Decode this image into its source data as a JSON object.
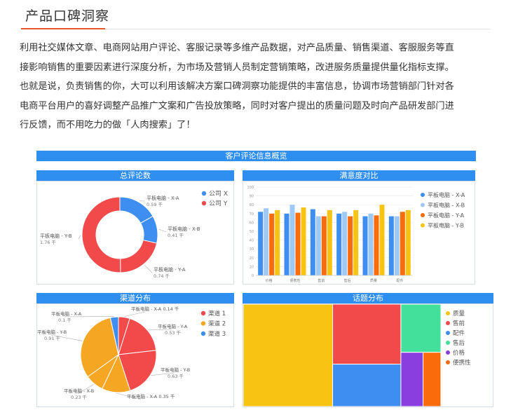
{
  "header": {
    "title": "产品口碑洞察"
  },
  "intro": {
    "lines": [
      "利用社交媒体文章、电商网站用户评论、客服记录等多维产品数据，对产品质量、销售渠道、客服服务等直",
      "接影响销售的重要因素进行深度分析，为市场及营销人员制定营销策略，改进服务质量提供量化指标支撑。",
      "也就是说，负责销售的你，大可以利用该解决方案口碑洞察功能提供的丰富信息，协调市场营销部门针对各",
      "电商平台用户的喜好调整产品推广文案和广告投放策略，同时对客户提出的质量问题及时向产品研发部门进",
      "行反馈，而不用吃力的做「人肉搜索」了！"
    ]
  },
  "dashboard": {
    "title": "客户评论信息概览"
  },
  "colors": {
    "blue": "#3d8ef0",
    "red": "#f24a4a",
    "orange": "#f5a623",
    "lightblue": "#9ec9f5",
    "yellow": "#f8c414",
    "green": "#43e09c",
    "purple": "#8a3ee0",
    "deeporange": "#f96b0b"
  },
  "chart_data": [
    {
      "type": "pie",
      "title": "总评论数",
      "legend": [
        "公司 X",
        "公司 Y"
      ],
      "slices": [
        {
          "label": "平板电脑 - X-A",
          "value": 0.59,
          "value_label": "0.59 千",
          "group": "公司 X"
        },
        {
          "label": "平板电脑 - X-B",
          "value": 0.41,
          "value_label": "0.41 千",
          "group": "公司 X"
        },
        {
          "label": "平板电脑 - Y-A",
          "value": 0.74,
          "value_label": "0.74 千",
          "group": "公司 Y"
        },
        {
          "label": "平板电脑 - Y-B",
          "value": 1.76,
          "value_label": "1.76 千",
          "group": "公司 Y"
        }
      ]
    },
    {
      "type": "bar",
      "title": "满意度对比",
      "categories": [
        "价格",
        "便携性",
        "售前",
        "售后",
        "质量",
        "配件"
      ],
      "ylim": [
        0,
        100
      ],
      "yticks": [
        0,
        10,
        20,
        30,
        40,
        50,
        60,
        70,
        80,
        90,
        100
      ],
      "series": [
        {
          "name": "平板电脑 - X-A",
          "values": [
            72,
            70,
            75,
            70,
            67,
            67
          ]
        },
        {
          "name": "平板电脑 - X-B",
          "values": [
            76,
            80,
            67,
            72,
            70,
            67
          ]
        },
        {
          "name": "平板电脑 - Y-A",
          "values": [
            70,
            71,
            67,
            67,
            68,
            72
          ]
        },
        {
          "name": "平板电脑 - Y-B",
          "values": [
            74,
            77,
            74,
            74,
            80,
            74
          ]
        }
      ]
    },
    {
      "type": "pie",
      "title": "渠道分布",
      "legend": [
        "渠道 1",
        "渠道 2",
        "渠道 3"
      ],
      "slices": [
        {
          "label": "平板电脑 - X-A",
          "value": 0.14,
          "value_label": "0.14 千",
          "group": "渠道 1"
        },
        {
          "label": "平板电脑 - Y-A",
          "value": 0.53,
          "value_label": "0.53 千",
          "group": "渠道 1"
        },
        {
          "label": "平板电脑 - Y-B",
          "value": 0.63,
          "value_label": "0.63 千",
          "group": "渠道 1"
        },
        {
          "label": "平板电脑 - X-A",
          "value": 0.35,
          "value_label": "0.35 千",
          "group": "渠道 2"
        },
        {
          "label": "平板电脑 - X-B",
          "value": 0.23,
          "value_label": "0.23 千",
          "group": "渠道 2"
        },
        {
          "label": "平板电脑 - Y-B",
          "value": 0.91,
          "value_label": "0.91 千",
          "group": "渠道 2"
        },
        {
          "label": "平板电脑 - X-A",
          "value": 0.1,
          "value_label": "0.1 千",
          "group": "渠道 3"
        }
      ]
    },
    {
      "type": "treemap",
      "title": "话题分布",
      "legend": [
        "质量",
        "售前",
        "配件",
        "售后",
        "价格",
        "便携性"
      ],
      "values": [
        38,
        17,
        12,
        8,
        5,
        4
      ]
    }
  ]
}
